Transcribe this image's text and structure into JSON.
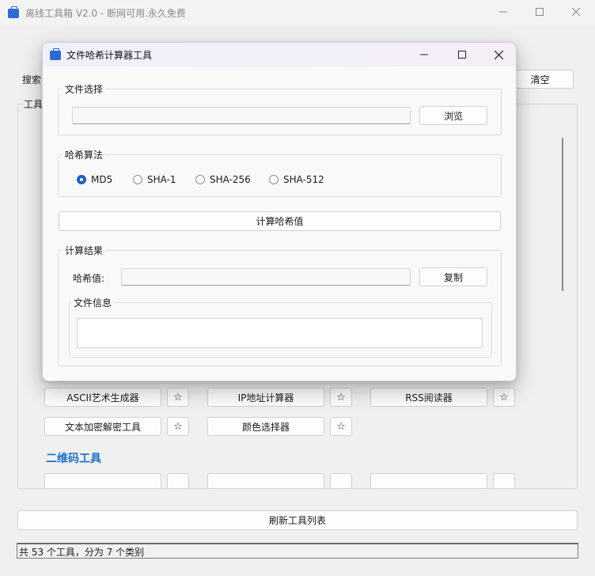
{
  "main": {
    "title": "离线工具箱 V2.0 - 断网可用.永久免费",
    "search_label": "搜索",
    "clear_button": "清空",
    "tools_group_label": "工具",
    "refresh_button": "刷新工具列表",
    "status_text": "共 53 个工具，分为 7 个类别",
    "section_qr": "二维码工具",
    "star_glyph": "☆",
    "tools": [
      {
        "label": "ASCII艺术生成器"
      },
      {
        "label": "IP地址计算器"
      },
      {
        "label": "RSS阅读器"
      },
      {
        "label": "文本加密解密工具"
      },
      {
        "label": "颜色选择器"
      }
    ]
  },
  "dialog": {
    "title": "文件哈希计算器工具",
    "file_group_label": "文件选择",
    "file_path_value": "",
    "browse_button": "浏览",
    "algo_group_label": "哈希算法",
    "algorithms": [
      {
        "label": "MD5",
        "checked": true
      },
      {
        "label": "SHA-1",
        "checked": false
      },
      {
        "label": "SHA-256",
        "checked": false
      },
      {
        "label": "SHA-512",
        "checked": false
      }
    ],
    "compute_button": "计算哈希值",
    "result_group_label": "计算结果",
    "hash_label": "哈希值:",
    "hash_value": "",
    "copy_button": "复制",
    "fileinfo_group_label": "文件信息",
    "fileinfo_value": ""
  },
  "colors": {
    "accent": "#1f5fc6",
    "section_title": "#1f6fc6",
    "icon_blue": "#2f6ad0"
  },
  "icons": {
    "app": "toolbox-icon",
    "minimize": "minimize-icon",
    "maximize": "maximize-icon",
    "close": "close-icon"
  }
}
